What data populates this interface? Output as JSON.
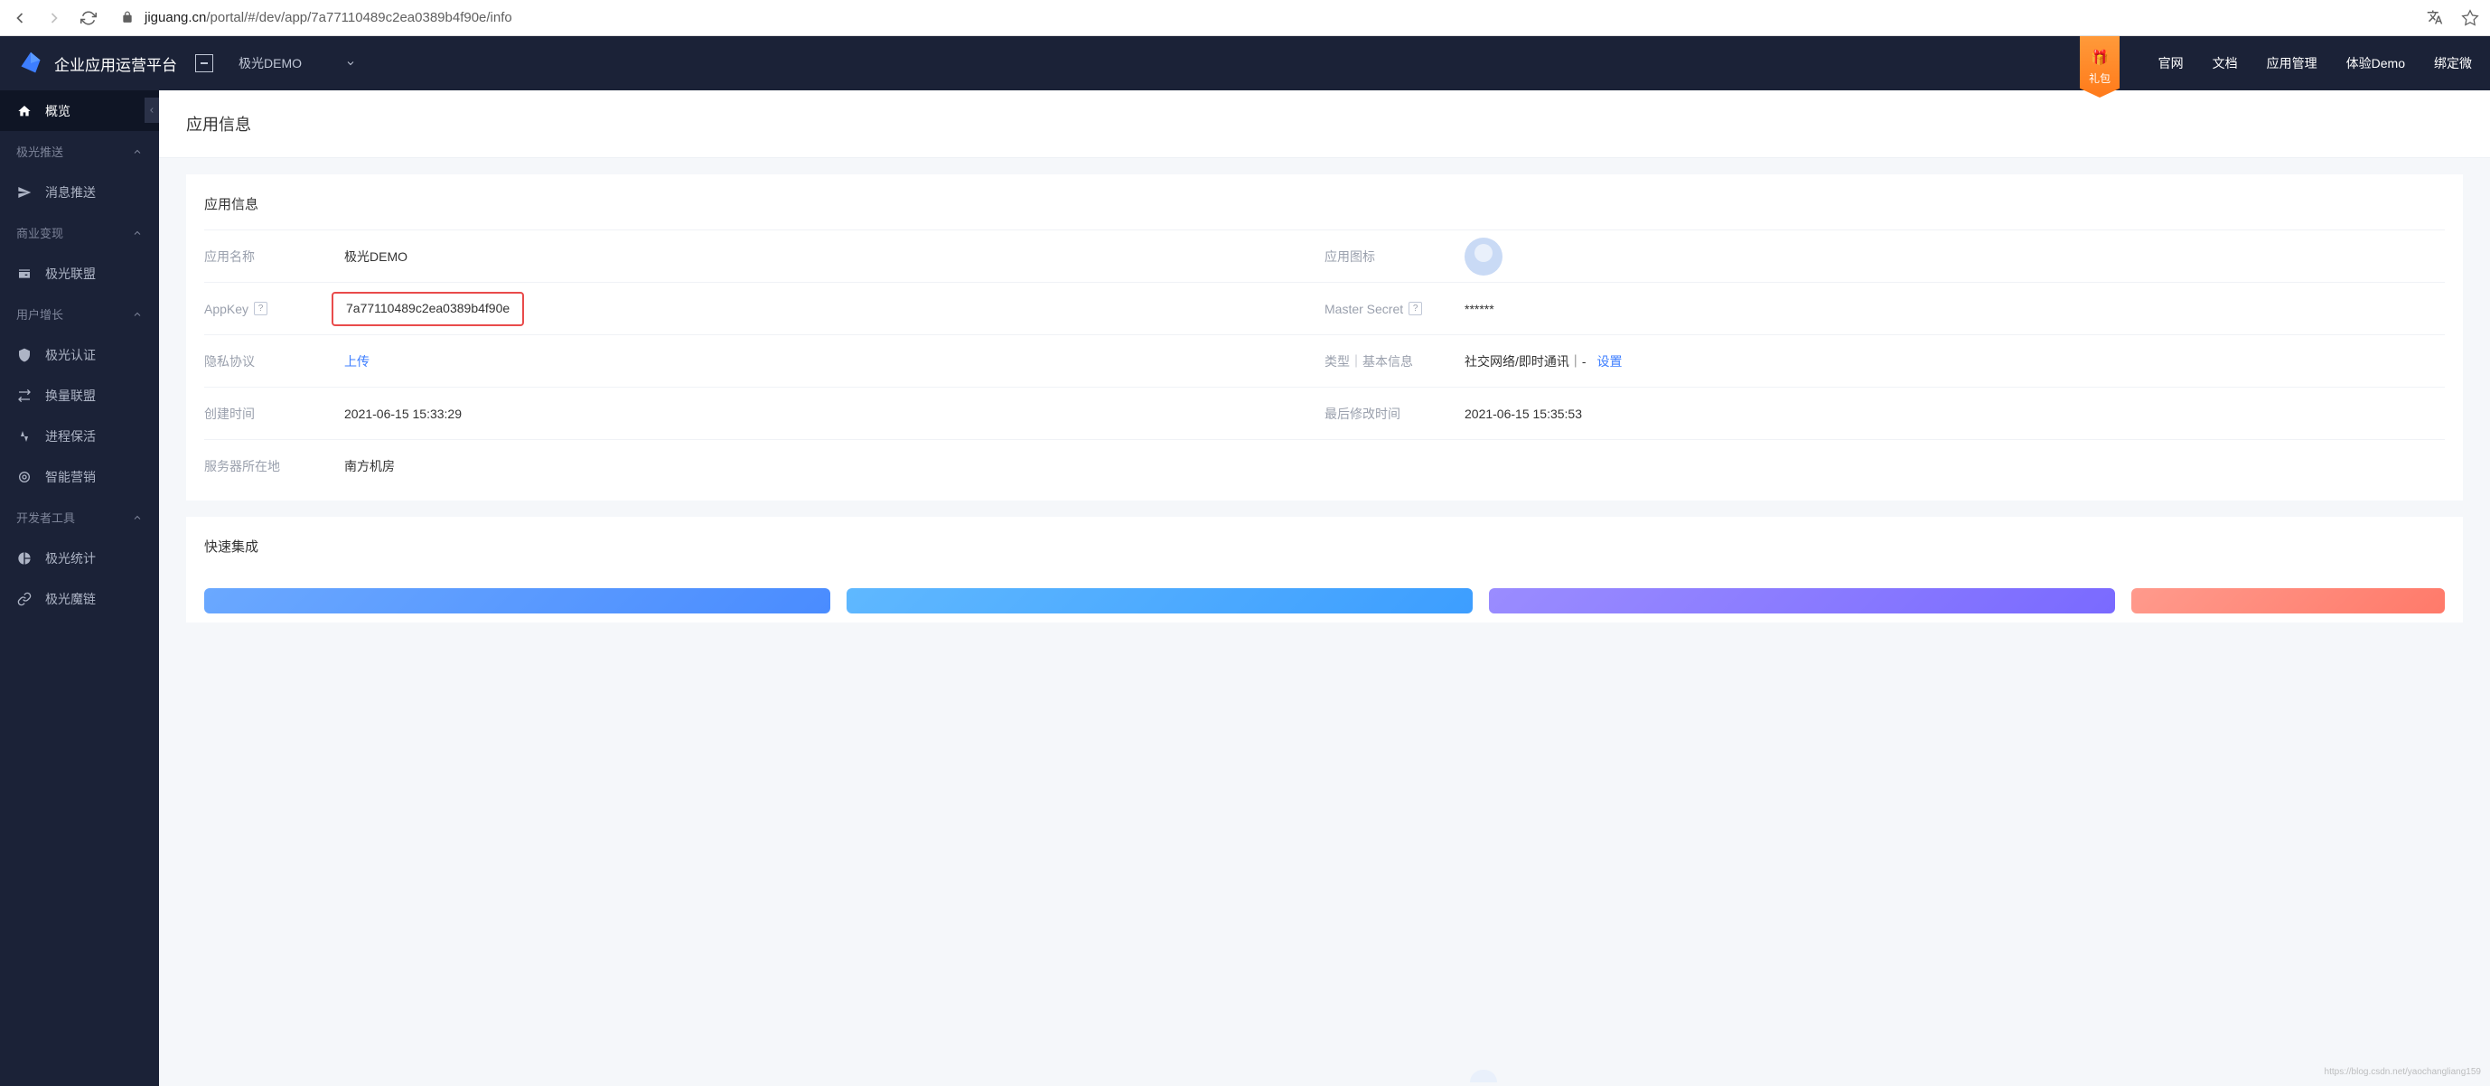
{
  "browser": {
    "domain": "jiguang.cn",
    "path": "/portal/#/dev/app/7a77110489c2ea0389b4f90e/info"
  },
  "header": {
    "platform_title": "企业应用运营平台",
    "app_selector": "极光DEMO",
    "gift_label": "礼包",
    "nav": [
      "官网",
      "文档",
      "应用管理",
      "体验Demo",
      "绑定微"
    ]
  },
  "sidebar": {
    "overview": "概览",
    "groups": [
      {
        "label": "极光推送",
        "items": [
          {
            "icon": "send",
            "label": "消息推送"
          }
        ]
      },
      {
        "label": "商业变现",
        "items": [
          {
            "icon": "wallet",
            "label": "极光联盟"
          }
        ]
      },
      {
        "label": "用户增长",
        "items": [
          {
            "icon": "shield",
            "label": "极光认证"
          },
          {
            "icon": "swap",
            "label": "换量联盟"
          },
          {
            "icon": "heart",
            "label": "进程保活"
          },
          {
            "icon": "target",
            "label": "智能营销"
          }
        ]
      },
      {
        "label": "开发者工具",
        "items": [
          {
            "icon": "pie",
            "label": "极光统计"
          },
          {
            "icon": "link",
            "label": "极光魔链"
          }
        ]
      }
    ]
  },
  "page": {
    "title": "应用信息",
    "card_title": "应用信息",
    "rows": {
      "app_name": {
        "label": "应用名称",
        "value": "极光DEMO"
      },
      "app_icon": {
        "label": "应用图标"
      },
      "appkey": {
        "label": "AppKey",
        "value": "7a77110489c2ea0389b4f90e"
      },
      "master_secret": {
        "label": "Master Secret",
        "value": "******"
      },
      "privacy": {
        "label": "隐私协议",
        "value": "上传"
      },
      "type_info": {
        "label": "类型｜基本信息",
        "value": "社交网络/即时通讯｜-",
        "action": "设置"
      },
      "created": {
        "label": "创建时间",
        "value": "2021-06-15 15:33:29"
      },
      "modified": {
        "label": "最后修改时间",
        "value": "2021-06-15 15:35:53"
      },
      "server": {
        "label": "服务器所在地",
        "value": "南方机房"
      }
    },
    "quick_title": "快速集成"
  },
  "watermark": "https://blog.csdn.net/yaochangliang159"
}
